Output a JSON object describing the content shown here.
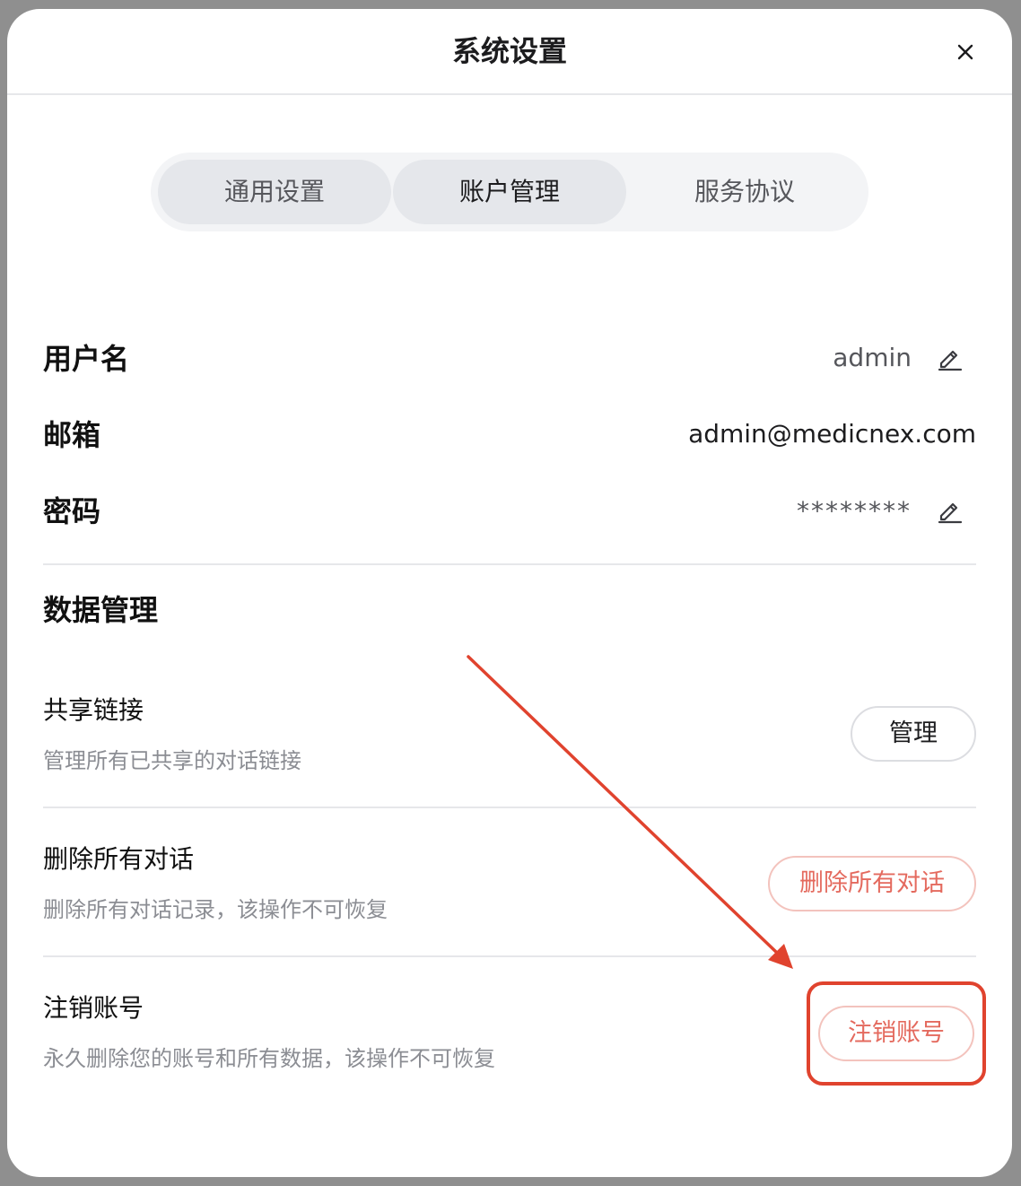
{
  "dialog": {
    "title": "系统设置",
    "close_icon": "close-icon"
  },
  "tabs": [
    {
      "label": "通用设置"
    },
    {
      "label": "账户管理",
      "active": true
    },
    {
      "label": "服务协议"
    }
  ],
  "account": {
    "username_label": "用户名",
    "username_value": "admin",
    "email_label": "邮箱",
    "email_value": "admin@medicnex.com",
    "password_label": "密码",
    "password_value": "********"
  },
  "data_management": {
    "title": "数据管理",
    "items": [
      {
        "title": "共享链接",
        "desc": "管理所有已共享的对话链接",
        "button": "管理"
      },
      {
        "title": "删除所有对话",
        "desc": "删除所有对话记录，该操作不可恢复",
        "button": "删除所有对话"
      },
      {
        "title": "注销账号",
        "desc": "永久删除您的账号和所有数据，该操作不可恢复",
        "button": "注销账号"
      }
    ]
  },
  "colors": {
    "danger": "#e46a5e",
    "annotation": "#e0432e"
  }
}
